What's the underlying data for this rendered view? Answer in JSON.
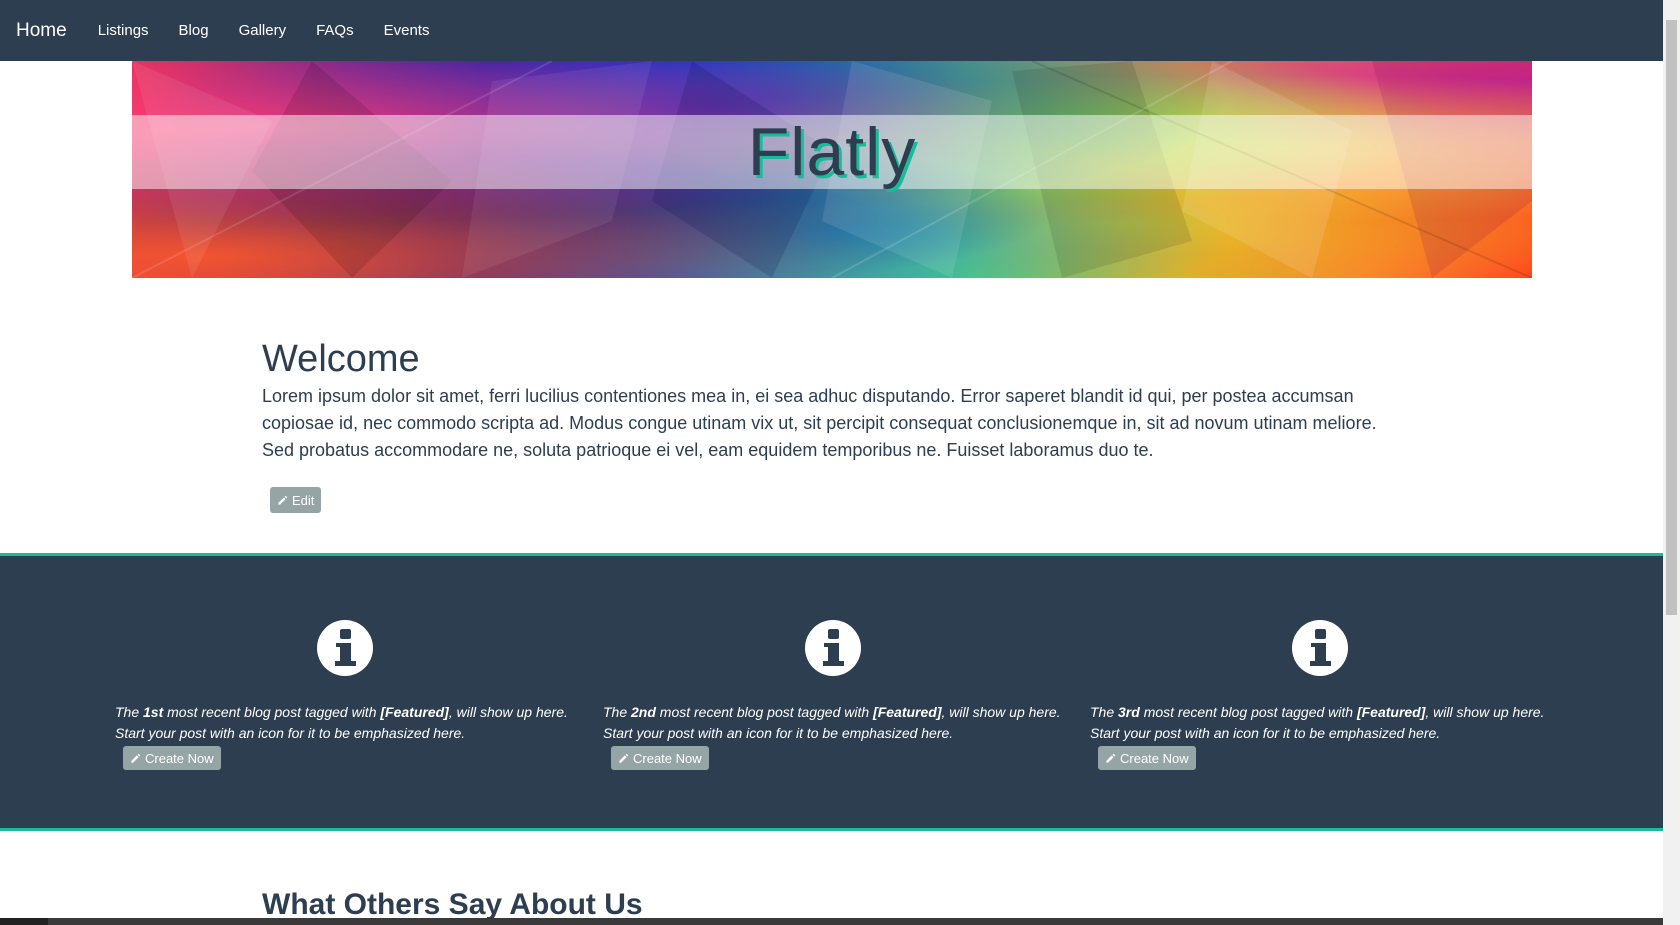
{
  "nav": {
    "brand": "Home",
    "links": [
      "Listings",
      "Blog",
      "Gallery",
      "FAQs",
      "Events"
    ]
  },
  "banner": {
    "title": "Flatly"
  },
  "welcome": {
    "heading": "Welcome",
    "body": "Lorem ipsum dolor sit amet, ferri lucilius contentiones mea in, ei sea adhuc disputando. Error saperet blandit id qui, per postea accumsan copiosae id, nec commodo scripta ad. Modus congue utinam vix ut, sit percipit consequat conclusionemque in, sit ad novum utinam meliore. Sed probatus accommodare ne, soluta patrioque ei vel, eam equidem temporibus ne. Fuisset laboramus duo te.",
    "edit_label": "Edit"
  },
  "featured": {
    "items": [
      {
        "prefix": "The ",
        "ordinal": "1st",
        "mid": " most recent blog post tagged with ",
        "tag": "[Featured]",
        "suffix": ", will show up here. Start your post with an icon for it to be emphasized here.",
        "button": "Create Now"
      },
      {
        "prefix": "The ",
        "ordinal": "2nd",
        "mid": " most recent blog post tagged with ",
        "tag": "[Featured]",
        "suffix": ", will show up here. Start your post with an icon for it to be emphasized here.",
        "button": "Create Now"
      },
      {
        "prefix": "The ",
        "ordinal": "3rd",
        "mid": " most recent blog post tagged with ",
        "tag": "[Featured]",
        "suffix": ", will show up here. Start your post with an icon for it to be emphasized here.",
        "button": "Create Now"
      }
    ]
  },
  "testimonials": {
    "heading": "What Others Say About Us"
  },
  "colors": {
    "primary": "#2c3e50",
    "accent": "#18bc9c",
    "button": "#95a5a6"
  },
  "icons": {
    "edit": "pencil-icon",
    "featured": "info-circle-icon"
  }
}
